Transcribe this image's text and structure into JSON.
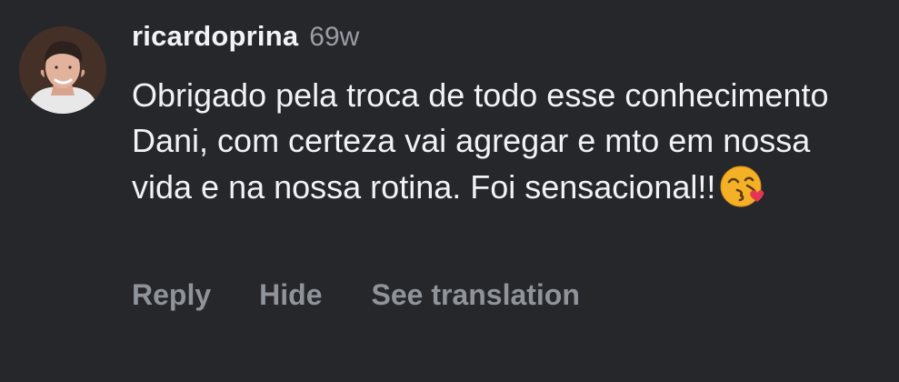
{
  "comment": {
    "username": "ricardoprina",
    "timestamp": "69w",
    "text": "Obrigado pela troca de todo esse conhecimento Dani, com certeza vai agregar e mto em nossa vida e na nossa rotina. Foi sensacional!!",
    "emoji_icon": "face-blowing-a-kiss-icon",
    "actions": {
      "reply": "Reply",
      "hide": "Hide",
      "see_translation": "See translation"
    }
  },
  "colors": {
    "background": "#25272b",
    "username": "#f2f3f5",
    "timestamp": "#9a9da3",
    "text": "#f1f2f4",
    "action": "#8f939a"
  }
}
